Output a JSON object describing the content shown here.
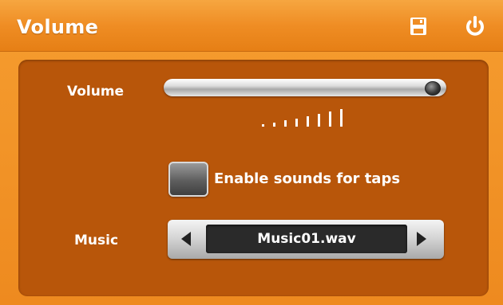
{
  "window": {
    "title": "Volume"
  },
  "header": {
    "save_icon": "save-icon",
    "power_icon": "power-icon"
  },
  "volume": {
    "label": "Volume",
    "level": 1.0,
    "bar_count": 8
  },
  "tap_sounds": {
    "label": "Enable sounds for taps",
    "checked": false
  },
  "music": {
    "label": "Music",
    "value": "Music01.wav",
    "prev_icon": "left-arrow-icon",
    "next_icon": "right-arrow-icon"
  },
  "colors": {
    "header": "#ef8d24",
    "panel": "#b8560a",
    "text": "#ffffff"
  }
}
